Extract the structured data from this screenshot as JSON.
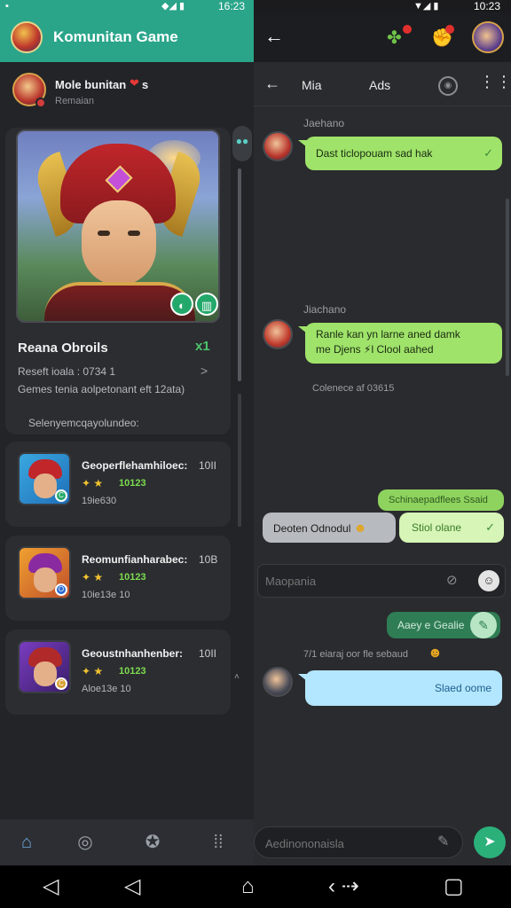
{
  "status_bar": {
    "left_glyphs": "▪",
    "right_glyphs_left": "◆◢ ▮",
    "time_left": "16:23",
    "right_glyphs_right": "▼◢ ▮",
    "time_right": "10:23"
  },
  "left": {
    "header_title": "Komunitan Game",
    "user": {
      "name": "Mole bunitan",
      "heart": "❤",
      "trail": "s",
      "sub": "Remaian"
    },
    "featured": {
      "title": "Reana Obroils",
      "badge": "x1",
      "line1": "Reseft ioala : 0734 1",
      "line2": "Gemes tenia aolpetonant eft 12ata)",
      "line3": "Selenyemcqayolundeo:",
      "chevron": ">"
    },
    "games": [
      {
        "title": "Geoperflehamhiloec:",
        "value": "10II",
        "score": "10123",
        "sub": "19ie630",
        "corner": "C"
      },
      {
        "title": "Reomunfianharabec:",
        "value": "10B",
        "score": "10123",
        "sub": "10ie13e 10",
        "corner": "O"
      },
      {
        "title": "Geoustnhanhenber:",
        "value": "10II",
        "score": "10123",
        "sub": "Aloe13e 10",
        "corner": "C"
      }
    ],
    "side_button_dots": "●●",
    "caret": "˄"
  },
  "nav_icons": [
    "home-icon",
    "circle-icon",
    "puzzle-icon",
    "grid-icon"
  ],
  "right": {
    "chat_name": "Mia",
    "ads_label": "Ads",
    "messages": [
      {
        "sender": "Jaehano",
        "text": "Dast ticlopouam sad hak"
      },
      {
        "sender": "Jiachano",
        "text_l1": "Ranle kan yn larne aned damk",
        "text_l2": "me Djens ⚡l Clool aahed"
      },
      {
        "system": "Colenece af 03615"
      }
    ],
    "top_green": "Schinaepadflees Ssaid",
    "grey_pill": "Deoten Odnodul",
    "light_pill": "Stiol olane",
    "search_placeholder": "Maopania",
    "dark_green": "Aaey e Gealie",
    "sys2": "7/1 eiaraj oor fle sebaud",
    "blue": "Slaed oome"
  },
  "compose": {
    "placeholder": "Aedinononaisla"
  },
  "colors": {
    "header_green": "#2aa58a",
    "bubble_green": "#9fe36a",
    "send_green": "#2bb07a",
    "accent_blue": "#6ea8e0"
  }
}
